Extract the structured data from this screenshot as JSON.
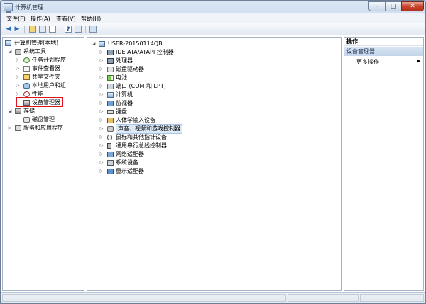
{
  "window": {
    "title": "计算机管理",
    "minimize": "–",
    "maximize": "□",
    "close": "✕"
  },
  "menu": [
    "文件(F)",
    "操作(A)",
    "查看(V)",
    "帮助(H)"
  ],
  "toolbar": {
    "back": "◀",
    "forward": "▶",
    "help": "?"
  },
  "tree": {
    "root": "计算机管理(本地)",
    "system_tools": "系统工具",
    "task_scheduler": "任务计划程序",
    "event_viewer": "事件查看器",
    "shared_folders": "共享文件夹",
    "local_users": "本地用户和组",
    "performance": "性能",
    "device_manager": "设备管理器",
    "storage": "存储",
    "disk_management": "磁盘管理",
    "services": "服务和应用程序"
  },
  "devices": {
    "computer": "USER-20150114QB",
    "items": [
      "IDE ATA/ATAPI 控制器",
      "处理器",
      "磁盘驱动器",
      "电池",
      "端口 (COM 和 LPT)",
      "计算机",
      "监视器",
      "键盘",
      "人体学输入设备",
      "声音、视频和游戏控制器",
      "鼠标和其他指针设备",
      "通用串行总线控制器",
      "网络适配器",
      "系统设备",
      "显示适配器"
    ],
    "icons": [
      "chip-icon",
      "chip-icon",
      "disk-icon",
      "battery-icon",
      "port-icon",
      "computer-icon",
      "monitor-icon",
      "keyboard-icon",
      "hid-icon",
      "sound-icon",
      "mouse-icon",
      "usb-icon",
      "network-icon",
      "system-icon",
      "display-icon"
    ]
  },
  "actions": {
    "header": "操作",
    "section": "设备管理器",
    "more": "更多操作",
    "more_arrow": "▶"
  },
  "expanders": {
    "expanded": "◢",
    "collapsed": "▷"
  },
  "colors": {
    "selection_outline": "#e0131a",
    "actions_section_bg": "#c3d5ea"
  }
}
